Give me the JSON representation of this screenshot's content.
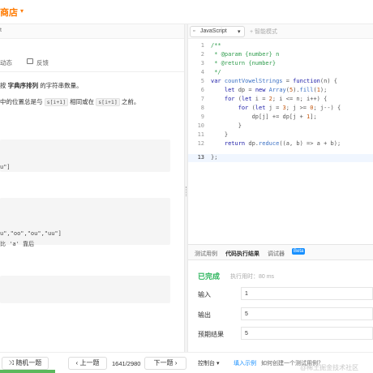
{
  "header": {
    "store": "商店",
    "caret": "▾"
  },
  "left": {
    "tab_partial": "t",
    "actions": [
      {
        "label": "动态"
      },
      {
        "label": "反馈",
        "icon": "feedback-icon"
      }
    ],
    "desc_line1_prefix": "按",
    "desc_line1_bold": "字典序排列",
    "desc_line1_suffix": "的字符串数量。",
    "desc_line2_prefix": "中的位置总是与",
    "desc_chip1": "s[i+1]",
    "desc_line2_mid": "相同或在",
    "desc_chip2": "s[i+1]",
    "desc_line2_suffix": "之前。",
    "example1_line": "u\"]",
    "example2_line1": "u\",\"oo\",\"ou\",\"uu\"]",
    "example2_line2": "比 'a' 靠后"
  },
  "bottom_left": {
    "random_icon": "shuffle-icon",
    "random": "随机一题",
    "prev": "上一题",
    "prev_icon": "chevron-left-icon",
    "page": "1641/2980",
    "next": "下一题",
    "next_icon": "chevron-right-icon"
  },
  "editor": {
    "language": "JavaScript",
    "smart_mode": "智能模式",
    "lines": [
      "1",
      "2",
      "3",
      "4",
      "5",
      "6",
      "7",
      "8",
      "9",
      "10",
      "11",
      "12",
      "13"
    ],
    "code": {
      "l1": "/**",
      "l2a": " * @param ",
      "l2b": "{number}",
      "l2c": " n",
      "l3a": " * @return ",
      "l3b": "{number}",
      "l4": " */",
      "l5a": "var ",
      "l5b": "countVowelStrings",
      "l5c": " = ",
      "l5d": "function",
      "l5e": "(n) {",
      "l6a": "    let ",
      "l6b": "dp",
      "l6c": " = ",
      "l6d": "new ",
      "l6e": "Array",
      "l6f": "(",
      "l6g": "5",
      "l6h": ").",
      "l6i": "fill",
      "l6j": "(",
      "l6k": "1",
      "l6l": ");",
      "l7a": "    for ",
      "l7b": "(",
      "l7c": "let ",
      "l7d": "i = ",
      "l7e": "2",
      "l7f": "; i <= n; i++) {",
      "l8a": "        for ",
      "l8b": "(",
      "l8c": "let ",
      "l8d": "j = ",
      "l8e": "3",
      "l8f": "; j >= ",
      "l8g": "0",
      "l8h": "; j--) {",
      "l9a": "            dp[j] += dp[j + ",
      "l9b": "1",
      "l9c": "];",
      "l10": "        }",
      "l11": "    }",
      "l12a": "    return ",
      "l12b": "dp.",
      "l12c": "reduce",
      "l12d": "((a, b) => a + b);",
      "l13": "};"
    }
  },
  "console": {
    "tabs": [
      "测试用例",
      "代码执行结果",
      "调试器"
    ],
    "beta": "Beta",
    "status": "已完成",
    "runtime": "执行用时：80 ms",
    "input_label": "输入",
    "input_value": "1",
    "output_label": "输出",
    "output_value": "5",
    "expected_label": "预期结果",
    "expected_value": "5"
  },
  "console_bottom": {
    "console": "控制台",
    "console_caret": "▾",
    "example": "填入示例",
    "hint": "如何创建一个测试用例？"
  },
  "watermark": "@稀土掘金技术社区"
}
